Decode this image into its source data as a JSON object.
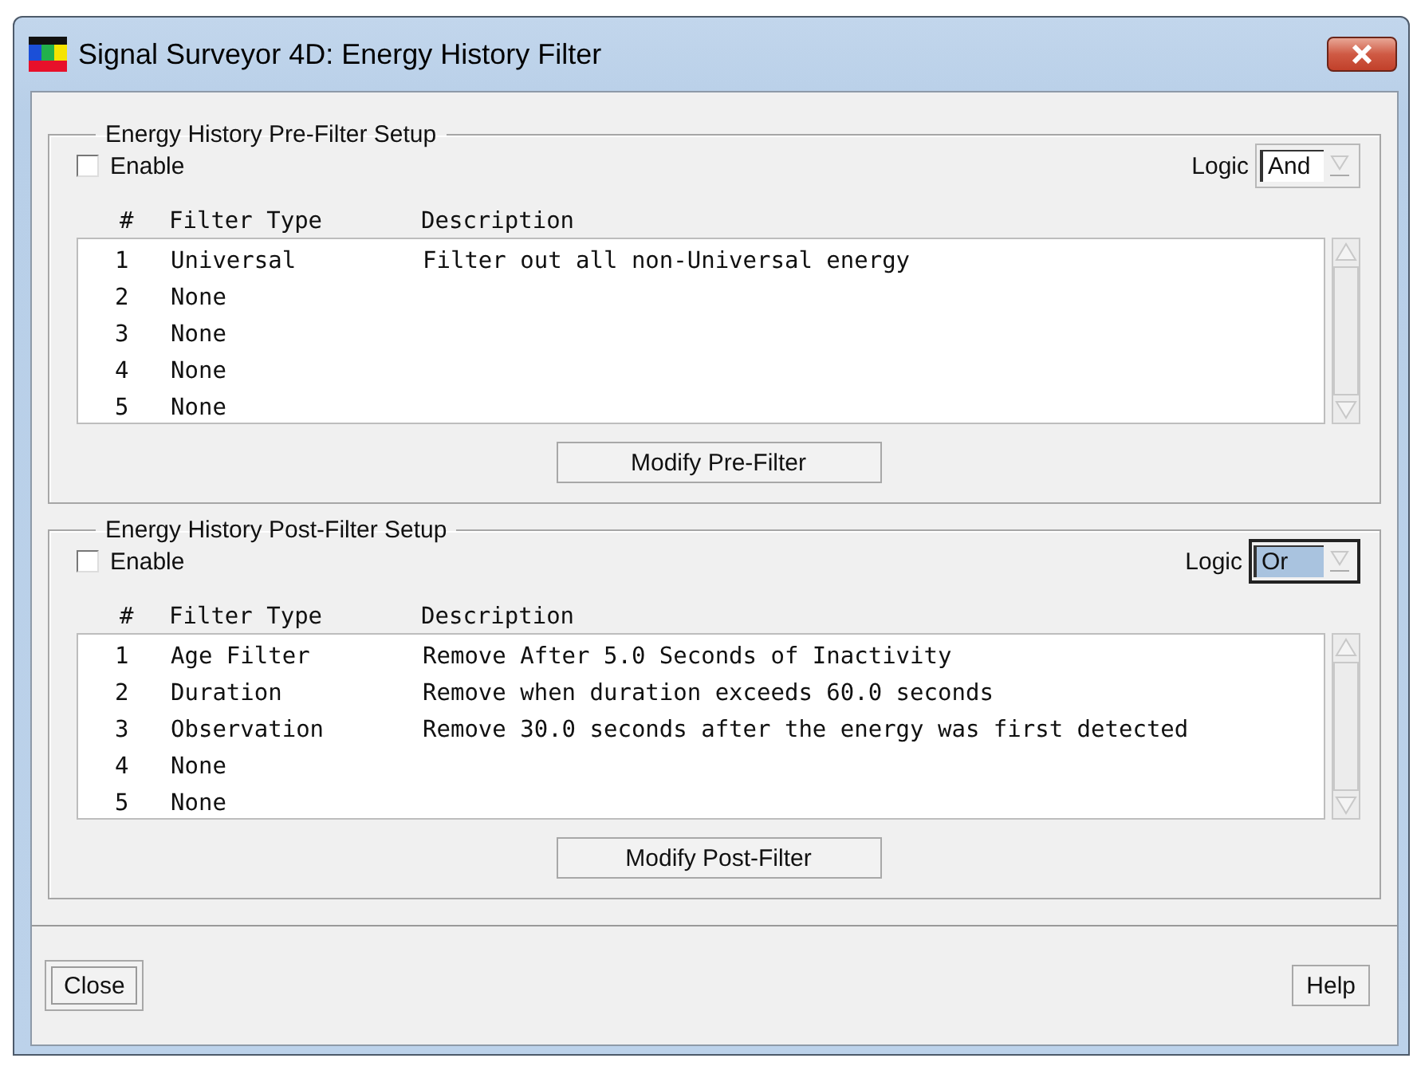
{
  "window": {
    "title": "Signal Surveyor 4D: Energy History Filter"
  },
  "sections": [
    {
      "legend": "Energy History Pre-Filter Setup",
      "enable": {
        "label": "Enable",
        "checked": false
      },
      "logic": {
        "label": "Logic",
        "value": "And",
        "focused": false
      },
      "columns": [
        "#",
        "Filter Type",
        "Description"
      ],
      "rows": [
        {
          "number": "1",
          "filter_type": "Universal",
          "description": "Filter out all non-Universal energy"
        },
        {
          "number": "2",
          "filter_type": "None"
        },
        {
          "number": "3",
          "filter_type": "None"
        },
        {
          "number": "4",
          "filter_type": "None"
        },
        {
          "number": "5",
          "filter_type": "None"
        }
      ],
      "button": "Modify Pre-Filter"
    },
    {
      "legend": "Energy History Post-Filter Setup",
      "enable": {
        "label": "Enable",
        "checked": false
      },
      "logic": {
        "label": "Logic",
        "value": "Or",
        "focused": true
      },
      "columns": [
        "#",
        "Filter Type",
        "Description"
      ],
      "rows": [
        {
          "number": "1",
          "filter_type": "Age Filter",
          "description": "Remove After 5.0 Seconds of Inactivity"
        },
        {
          "number": "2",
          "filter_type": "Duration",
          "description": "Remove when duration exceeds 60.0 seconds"
        },
        {
          "number": "3",
          "filter_type": "Observation",
          "description": "Remove 30.0 seconds after the energy was first detected"
        },
        {
          "number": "4",
          "filter_type": "None"
        },
        {
          "number": "5",
          "filter_type": "None"
        }
      ],
      "button": "Modify Post-Filter"
    }
  ],
  "footer_buttons": [
    {
      "label": "Close",
      "focused": true
    },
    {
      "label": "Help",
      "focused": false
    }
  ]
}
